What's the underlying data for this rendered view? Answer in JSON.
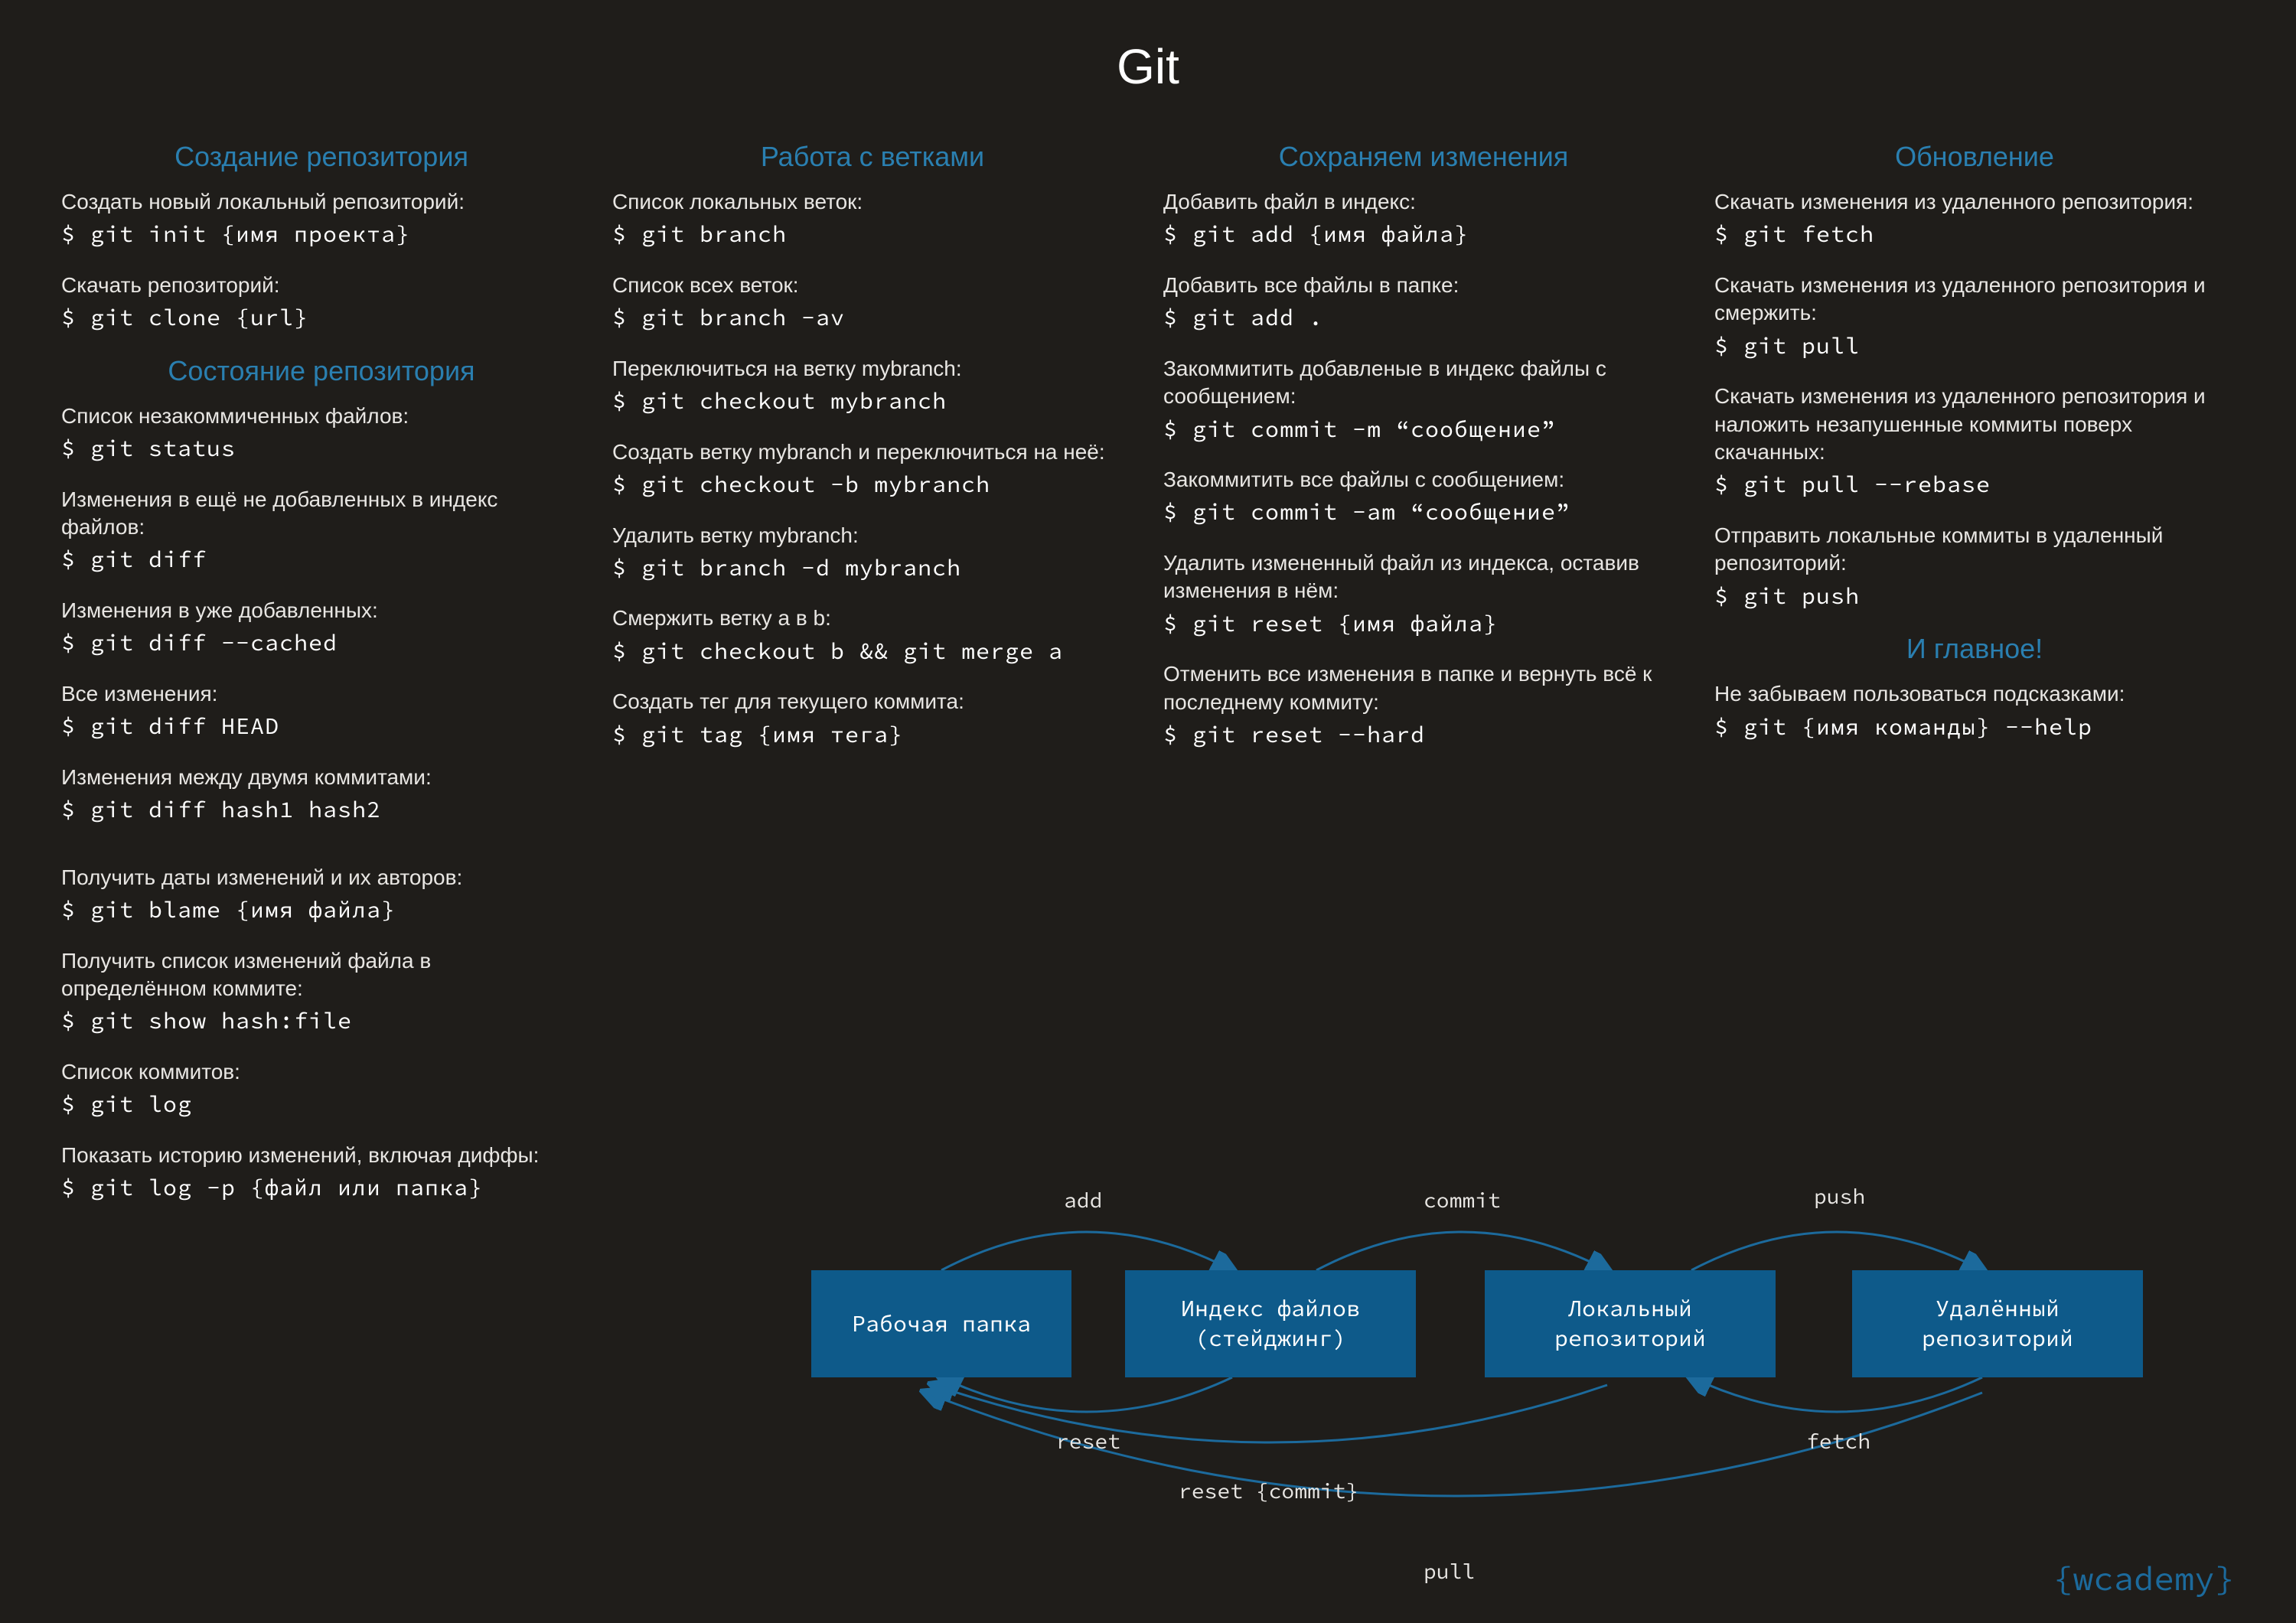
{
  "title": "Git",
  "brand": "{wcademy}",
  "columns": [
    {
      "sections": [
        {
          "title": "Создание репозитория",
          "items": [
            {
              "desc": "Создать новый локальный репозиторий:",
              "cmd": "$ git init {имя проекта}"
            },
            {
              "desc": "Скачать репозиторий:",
              "cmd": "$ git clone {url}"
            }
          ]
        },
        {
          "title": "Состояние репозитория",
          "items": [
            {
              "desc": "Список незакоммиченных файлов:",
              "cmd": "$ git status"
            },
            {
              "desc": "Изменения в ещё не добавленных в индекс файлов:",
              "cmd": "$ git diff"
            },
            {
              "desc": "Изменения в уже добавленных:",
              "cmd": "$ git diff --cached"
            },
            {
              "desc": "Все изменения:",
              "cmd": "$ git diff HEAD"
            },
            {
              "desc": "Изменения между двумя коммитами:",
              "cmd": "$ git diff hash1 hash2"
            },
            {
              "desc": "Получить даты изменений и их авторов:",
              "cmd": "$ git blame {имя файла}"
            },
            {
              "desc": "Получить список изменений файла в определённом коммите:",
              "cmd": "$ git show hash:file"
            },
            {
              "desc": "Список коммитов:",
              "cmd": "$ git log"
            },
            {
              "desc": " Показать историю изменений, включая диффы:",
              "cmd": "$ git log -p {файл или папка}"
            }
          ]
        }
      ]
    },
    {
      "sections": [
        {
          "title": "Работа с ветками",
          "items": [
            {
              "desc": "Список локальных веток:",
              "cmd": "$ git branch"
            },
            {
              "desc": "Список всех веток:",
              "cmd": "$ git branch -av"
            },
            {
              "desc": "Переключиться на ветку mybranch:",
              "cmd": "$ git checkout mybranch"
            },
            {
              "desc": "Создать ветку mybranch и переключиться на неё:",
              "cmd": "$ git checkout -b mybranch"
            },
            {
              "desc": "Удалить ветку mybranch:",
              "cmd": "$ git branch -d mybranch"
            },
            {
              "desc": "Смержить ветку a в b:",
              "cmd": "$ git checkout b && git merge a"
            },
            {
              "desc": "Создать тег для текущего коммита:",
              "cmd": "$ git tag {имя тега}"
            }
          ]
        }
      ]
    },
    {
      "sections": [
        {
          "title": "Сохраняем изменения",
          "items": [
            {
              "desc": "Добавить файл в индекс:",
              "cmd": "$ git add {имя файла}"
            },
            {
              "desc": "Добавить все файлы в папке:",
              "cmd": "$ git add ."
            },
            {
              "desc": "Закоммитить добавленые в индекс файлы с сообщением:",
              "cmd": "$ git commit -m “сообщение”"
            },
            {
              "desc": "Закоммитить все файлы с сообщением:",
              "cmd": "$ git commit -am “сообщение”"
            },
            {
              "desc": "Удалить измененный файл из индекса, оставив изменения в нём:",
              "cmd": "$ git reset {имя файла}"
            },
            {
              "desc": "Отменить все изменения в папке и вернуть всё к последнему коммиту:",
              "cmd": "$ git reset --hard"
            }
          ]
        }
      ]
    },
    {
      "sections": [
        {
          "title": "Обновление",
          "items": [
            {
              "desc": "Скачать изменения из удаленного репозитория:",
              "cmd": "$ git fetch"
            },
            {
              "desc": "Скачать изменения из удаленного репозитория и смержить:",
              "cmd": "$ git pull"
            },
            {
              "desc": "Скачать изменения из удаленного репозитория и наложить незапушенные коммиты поверх скачанных:",
              "cmd": "$ git pull --rebase"
            },
            {
              "desc": "Отправить локальные коммиты в удаленный репозиторий:",
              "cmd": "$ git push"
            }
          ]
        },
        {
          "title": "И главное!",
          "items": [
            {
              "desc": "Не забываем пользоваться подсказками:",
              "cmd": "$ git {имя команды} --help"
            }
          ]
        }
      ]
    }
  ],
  "diagram": {
    "boxes": [
      "Рабочая папка",
      "Индекс файлов (стейджинг)",
      "Локальный репозиторий",
      "Удалённый репозиторий"
    ],
    "labels": {
      "add": "add",
      "commit": "commit",
      "push": "push",
      "reset": "reset",
      "reset_commit": "reset {commit}",
      "fetch": "fetch",
      "pull": "pull"
    }
  }
}
